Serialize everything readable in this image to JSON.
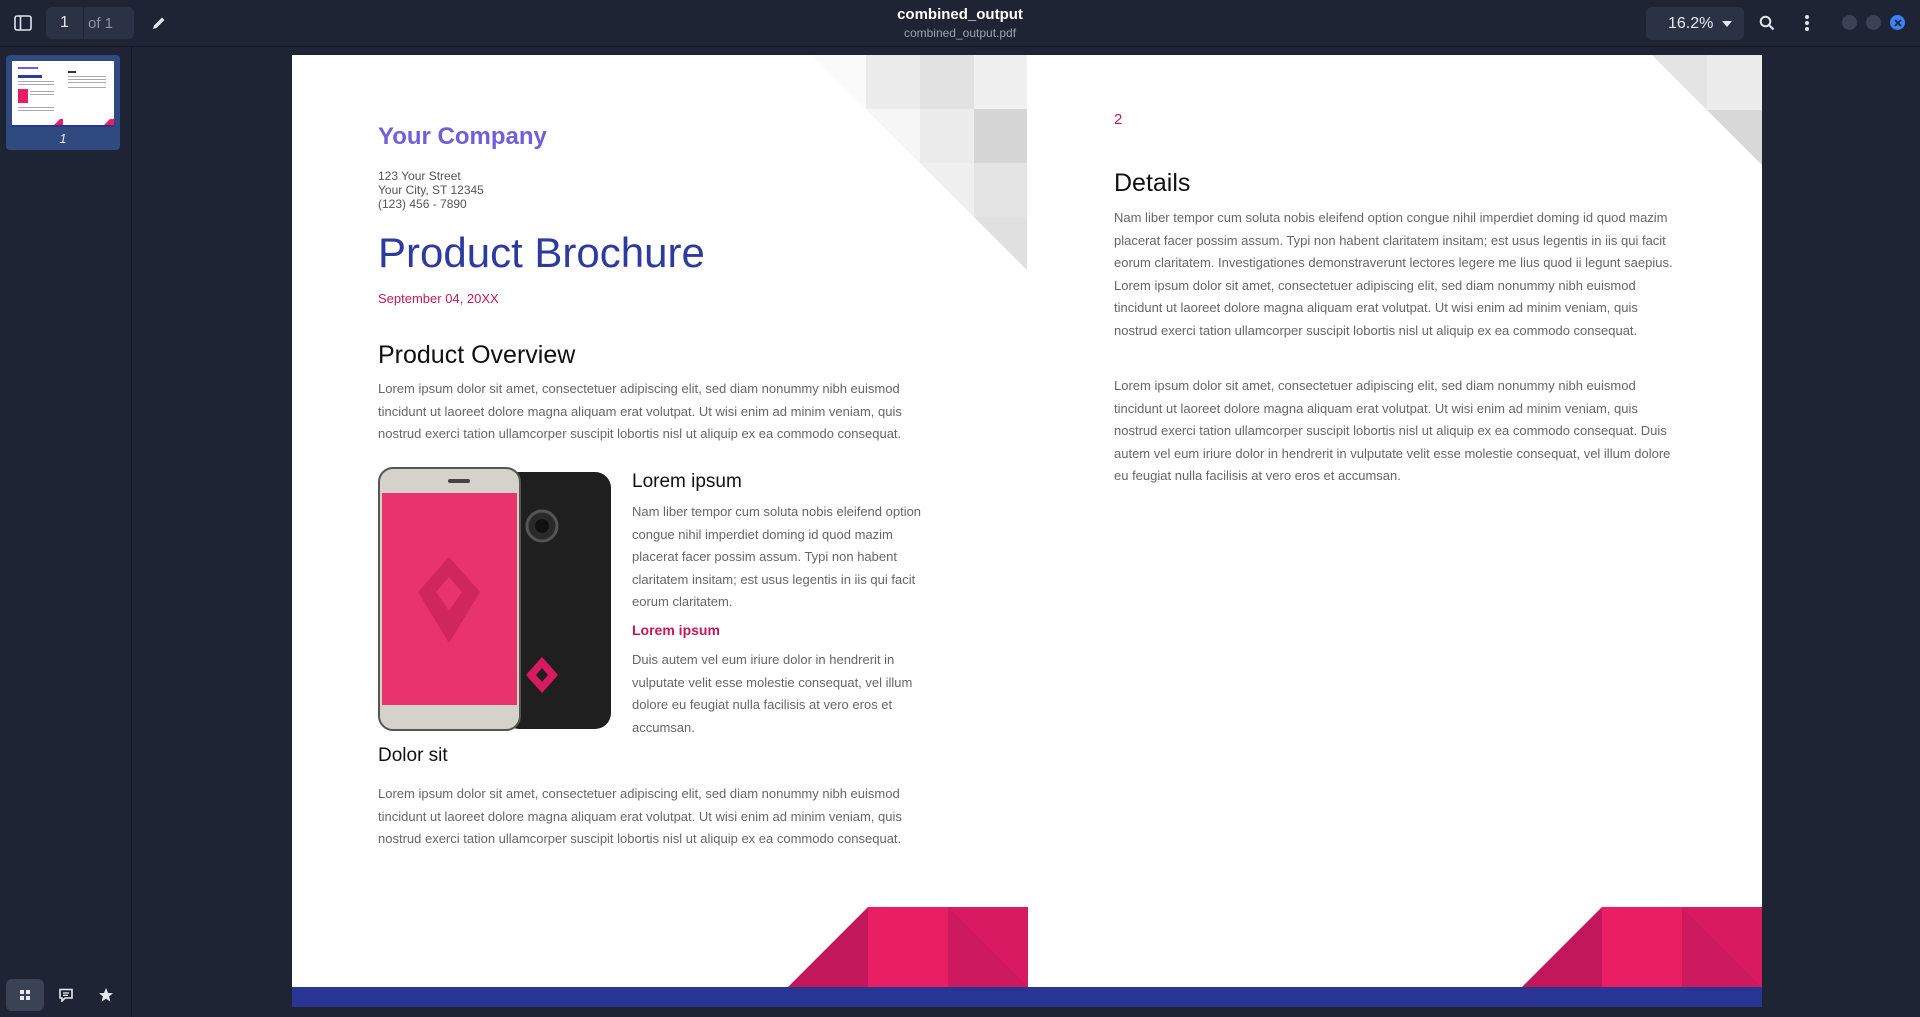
{
  "toolbar": {
    "current_page": "1",
    "page_of": "of 1",
    "title": "combined_output",
    "filename": "combined_output.pdf",
    "zoom": "16.2%"
  },
  "sidebar": {
    "thumbnail_label": "1"
  },
  "document": {
    "company": "Your Company",
    "address_line1": "123 Your Street",
    "address_line2": "Your City, ST 12345",
    "phone": "(123) 456 - 7890",
    "title": "Product Brochure",
    "date": "September 04, 20XX",
    "overview_heading": "Product Overview",
    "overview_text": "Lorem ipsum dolor sit amet, consectetuer adipiscing elit, sed diam nonummy nibh euismod tincidunt ut laoreet dolore magna aliquam erat volutpat. Ut wisi enim ad minim veniam, quis nostrud exerci tation ullamcorper suscipit lobortis nisl ut aliquip ex ea commodo consequat.",
    "lorem_heading": "Lorem ipsum",
    "lorem_text": "Nam liber tempor cum soluta nobis eleifend option congue nihil imperdiet doming id quod mazim placerat facer possim assum. Typi non habent claritatem insitam; est usus legentis in iis qui facit eorum claritatem.",
    "lorem_sub_heading": "Lorem ipsum",
    "lorem_sub_text": "Duis autem vel eum iriure dolor in hendrerit in vulputate velit esse molestie consequat, vel illum dolore eu feugiat nulla facilisis at vero eros et accumsan.",
    "dolor_heading": "Dolor sit",
    "dolor_text": "Lorem ipsum dolor sit amet, consectetuer adipiscing elit, sed diam nonummy nibh euismod tincidunt ut laoreet dolore magna aliquam erat volutpat. Ut wisi enim ad minim veniam, quis nostrud exerci tation ullamcorper suscipit lobortis nisl ut aliquip ex ea commodo consequat.",
    "page2_number": "2",
    "details_heading": "Details",
    "details_text1": "Nam liber tempor cum soluta nobis eleifend option congue nihil imperdiet doming id quod mazim placerat facer possim assum. Typi non habent claritatem insitam; est usus legentis in iis qui facit eorum claritatem. Investigationes demonstraverunt lectores legere me lius quod ii legunt saepius. Lorem ipsum dolor sit amet, consectetuer adipiscing elit, sed diam nonummy nibh euismod tincidunt ut laoreet dolore magna aliquam erat volutpat. Ut wisi enim ad minim veniam, quis nostrud exerci tation ullamcorper suscipit lobortis nisl ut aliquip ex ea commodo consequat.",
    "details_text2": "Lorem ipsum dolor sit amet, consectetuer adipiscing elit, sed diam nonummy nibh euismod tincidunt ut laoreet dolore magna aliquam erat volutpat. Ut wisi enim ad minim veniam, quis nostrud exerci tation ullamcorper suscipit lobortis nisl ut aliquip ex ea commodo consequat. Duis autem vel eum iriure dolor in hendrerit in vulputate velit esse molestie consequat, vel illum dolore eu feugiat nulla facilisis at vero eros et accumsan."
  },
  "colors": {
    "accent_pink": "#c2185b",
    "company_purple": "#6f5fdb",
    "title_blue": "#2d3a9e",
    "footer_bar": "#283593",
    "close_button": "#3b82f6"
  },
  "icons": [
    "sidebar-toggle-icon",
    "pencil-icon",
    "chevron-down-icon",
    "search-icon",
    "kebab-menu-icon",
    "close-icon",
    "grid-icon",
    "comment-icon",
    "star-icon"
  ]
}
